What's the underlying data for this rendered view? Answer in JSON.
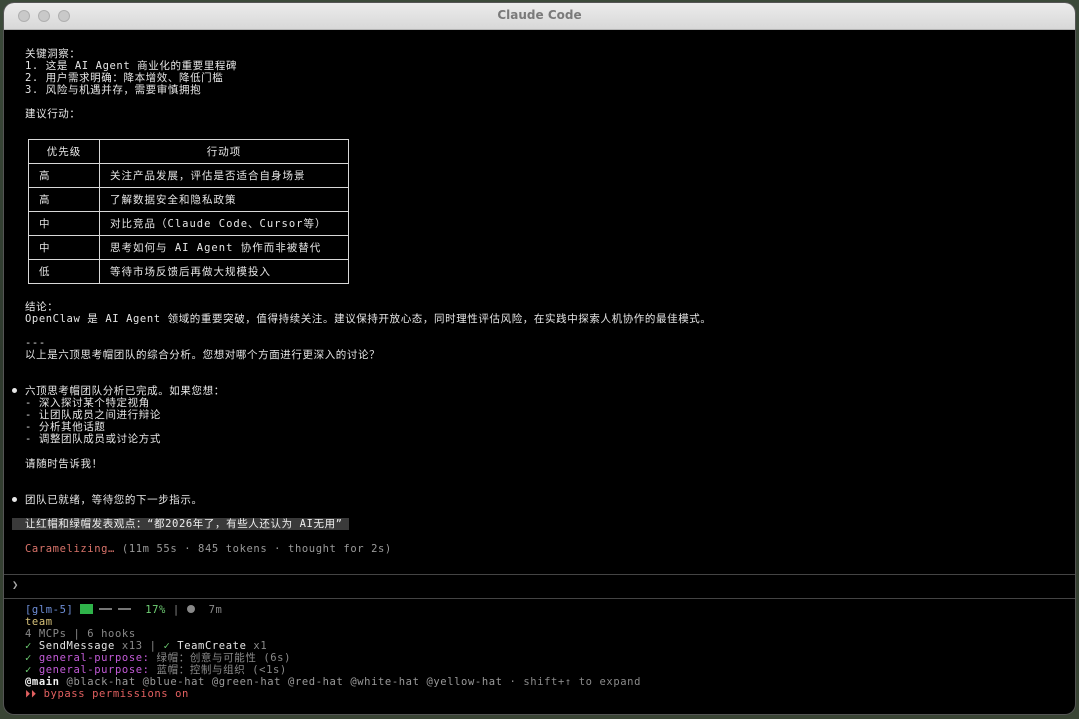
{
  "window": {
    "title": "Claude Code"
  },
  "content": {
    "insights_title": "关键洞察：",
    "insights": [
      "1. 这是 AI Agent 商业化的重要里程碑",
      "2. 用户需求明确：降本增效、降低门槛",
      "3. 风险与机遇并存，需要审慎拥抱"
    ],
    "actions_title": "建议行动：",
    "table": {
      "headers": [
        "优先级",
        "行动项"
      ],
      "rows": [
        [
          "高",
          "关注产品发展，评估是否适合自身场景"
        ],
        [
          "高",
          "了解数据安全和隐私政策"
        ],
        [
          "中",
          "对比竞品（Claude Code、Cursor等）"
        ],
        [
          "中",
          "思考如何与 AI Agent 协作而非被替代"
        ],
        [
          "低",
          "等待市场反馈后再做大规模投入"
        ]
      ]
    },
    "conclusion_title": "结论：",
    "conclusion_text": "OpenClaw 是 AI Agent 领域的重要突破，值得持续关注。建议保持开放心态，同时理性评估风险，在实践中探索人机协作的最佳模式。",
    "separator": "---",
    "summary_question": "以上是六顶思考帽团队的综合分析。您想对哪个方面进行更深入的讨论？",
    "message1_intro": "六顶思考帽团队分析已完成。如果您想：",
    "message1_options": [
      "- 深入探讨某个特定视角",
      "- 让团队成员之间进行辩论",
      "- 分析其他话题",
      "- 调整团队成员或讨论方式"
    ],
    "message1_outro": "请随时告诉我！",
    "message2": "团队已就绪，等待您的下一步指示。",
    "user_prompt": "让红帽和绿帽发表观点：“都2026年了，有些人还认为 AI无用”",
    "status_word": "Caramelizing…",
    "status_detail": "(11m 55s · 845 tokens · thought for 2s)"
  },
  "input": {
    "prompt_symbol": "❯",
    "value": ""
  },
  "footer": {
    "model": "[glm-5]",
    "context_percent": "17%",
    "separator": "|",
    "elapsed": "7m",
    "team_label": "team",
    "mcps": "4 MCPs | 6 hooks",
    "tools_line": {
      "check1": "✓",
      "tool1": "SendMessage",
      "count1": "x13",
      "sep": "|",
      "check2": "✓",
      "tool2": "TeamCreate",
      "count2": "x1"
    },
    "agents": [
      {
        "check": "✓",
        "name": "general-purpose:",
        "desc": "绿帽：创意与可能性 (6s)"
      },
      {
        "check": "✓",
        "name": "general-purpose:",
        "desc": "蓝帽：控制与组织 (<1s)"
      }
    ],
    "main_tag": "@main",
    "hats": "@black-hat @blue-hat @green-hat @red-hat @white-hat @yellow-hat",
    "expand_hint": "· shift+↑ to expand",
    "bypass_symbol": "⏵⏵",
    "bypass_text": "bypass permissions on"
  },
  "colors": {
    "status": "#d9736a",
    "progress": "#2fb34a",
    "agent_name": "#c35bd8",
    "bypass": "#e26060"
  }
}
